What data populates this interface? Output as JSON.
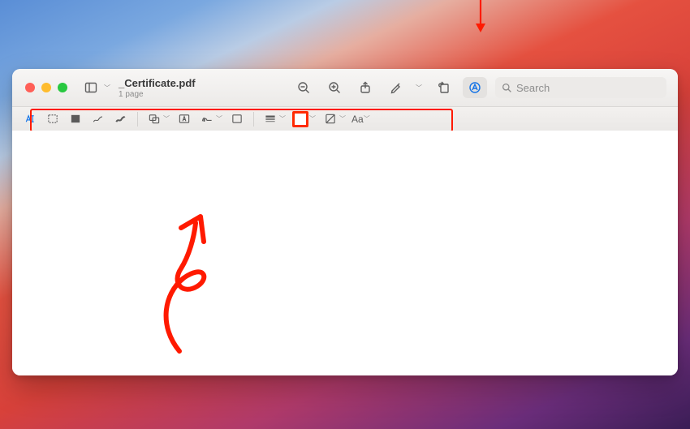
{
  "window": {
    "doc_title": "_Certificate.pdf",
    "page_count": "1 page",
    "search_placeholder": "Search"
  },
  "toolbar": {
    "sidebar_menu": "sidebar",
    "zoom_out": "zoom-out",
    "zoom_in": "zoom-in",
    "share": "share",
    "highlight": "highlight",
    "rotate": "rotate",
    "markup": "markup"
  },
  "markup_bar": {
    "text_select": "A|",
    "rect_select": "rect",
    "redact": "redact",
    "draw": "draw",
    "sketch": "sketch",
    "shapes": "shapes",
    "text_box": "text-box",
    "sign": "sign",
    "note": "note",
    "line_style": "line-style",
    "border_color": "border-color",
    "fill_color": "fill-color",
    "text_style_label": "Aa"
  },
  "annotations": {
    "arrow_points_to": "markup-toolbar-button",
    "red_box_highlights": "markup toolbar",
    "canvas_drawing": "curly arrow sketch"
  }
}
